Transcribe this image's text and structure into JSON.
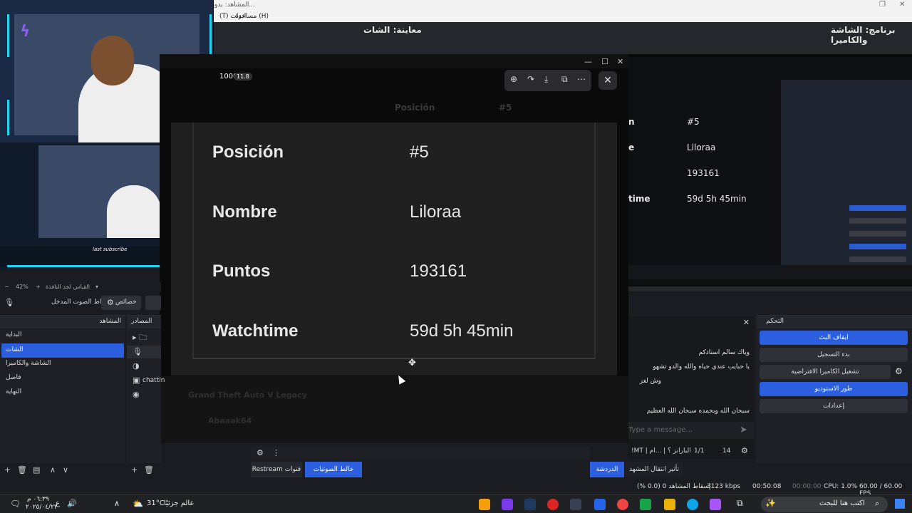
{
  "window": {
    "title": "المشاهد: بدون ع..."
  },
  "menu": {
    "items": [
      "(T) ادوات",
      "مساعدة (H)"
    ]
  },
  "preview": {
    "preview_label": "معاينة: الشات",
    "program_label": "برنامج: الشاشة والكاميرا"
  },
  "viewer": {
    "badge_number": "1000",
    "badge_likes": "11.8",
    "tools": [
      "⊕",
      "↷",
      "⤓",
      "⧉",
      "⋯"
    ],
    "close": "✕",
    "faint_header": "Posición",
    "faint_value": "#5",
    "faint_bottom_1": "Grand Theft Auto V Legacy",
    "faint_bottom_2": "Abaaak64",
    "rows": [
      {
        "label": "Posición",
        "value": "#5"
      },
      {
        "label": "Nombre",
        "value": "Liloraa"
      },
      {
        "label": "Puntos",
        "value": "193161"
      },
      {
        "label": "Watchtime",
        "value": "59d 5h 45min"
      }
    ]
  },
  "program_rows": [
    {
      "label": "n",
      "value": "#5"
    },
    {
      "label": "e",
      "value": "Liloraa"
    },
    {
      "label": "",
      "value": "193161"
    },
    {
      "label": "time",
      "value": "59d 5h 45min"
    }
  ],
  "webcam": {
    "overlay_text": "last subscribe"
  },
  "zoom": {
    "level": "42%",
    "text": "القياس لحد النافذة"
  },
  "audio_controls": {
    "mic_label": "التقاط الصوت المدخل",
    "props_label": "خصائص"
  },
  "scenes": {
    "title": "المشاهد",
    "items": [
      "البداية",
      "الشات",
      "الشاشة والكاميرا",
      "فاصل",
      "النهاية"
    ],
    "selected_index": 1
  },
  "sources": {
    "title": "المصادر",
    "items": [
      "",
      "",
      "",
      "chattin",
      ""
    ]
  },
  "chat": {
    "messages": [
      "وياك سالم استاذكم",
      "يا حبايب عندي حياه والله والدو تشهو",
      "وش لغز",
      "سبحان الله وبحمده سبحان الله العظيم"
    ],
    "placeholder": "Type a message...",
    "channel": "!MT | البارانز ؟ | ...ام",
    "viewer_count": "14",
    "ratio": "1/1"
  },
  "controls": {
    "title": "التحكم",
    "buttons": [
      {
        "label": "ايقاف البث",
        "style": "blue"
      },
      {
        "label": "بدء التسجيل",
        "style": "gray"
      },
      {
        "label": "تشغيل الكاميرا الافتراضية",
        "style": "gray"
      },
      {
        "label": "طور الاستوديو",
        "style": "blue"
      },
      {
        "label": "إعدادات",
        "style": "gray"
      }
    ]
  },
  "bottom_tabs": {
    "restream": "Restream قنوات",
    "mixer": "خالط الصوتيات",
    "live": "الدردشة",
    "transitions": "تأثير انتقال المشهد"
  },
  "status": {
    "dropped": "إسقاط المشاهد 0 (0.0 %)",
    "bitrate": "3123 kbps",
    "live_time": "00:50:08",
    "rec_time": "00:00:00",
    "cpu": "CPU: 1.0%",
    "fps": "60.00 / 60.00 FPS"
  },
  "taskbar": {
    "time": "٠٦:٣٩ م",
    "date": "٢٠٢٥/٠٤/٢٢",
    "lang": "ع",
    "weather": "31°C",
    "weather_label": "عالم جزئيًا",
    "search_placeholder": "اكتب هنا للبحث"
  }
}
